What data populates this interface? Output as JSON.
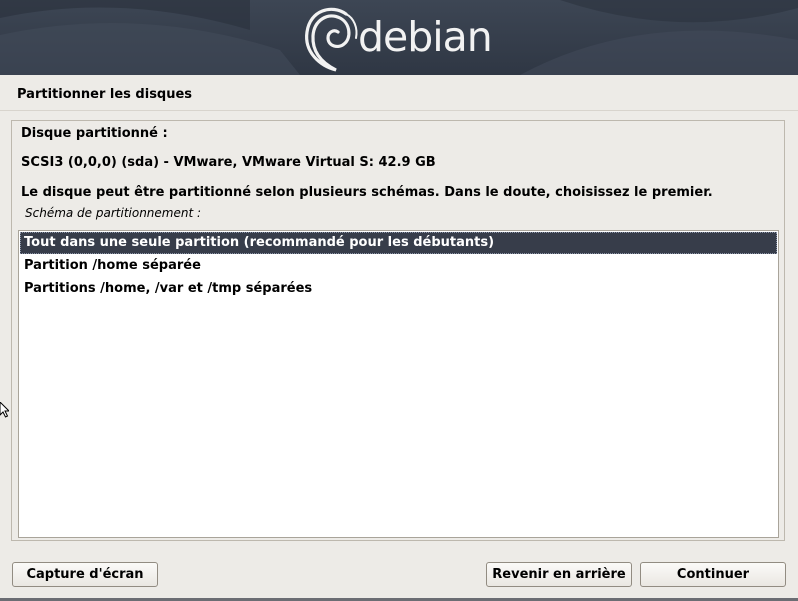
{
  "banner": {
    "logo_text": "debian"
  },
  "page": {
    "title": "Partitionner les disques"
  },
  "panel": {
    "disk_label": "Disque partitionné :",
    "disk_value": "SCSI3 (0,0,0) (sda) - VMware, VMware Virtual S: 42.9 GB",
    "description": "Le disque peut être partitionné selon plusieurs schémas. Dans le doute, choisissez le premier.",
    "scheme_label": "Schéma de partitionnement :"
  },
  "schemes": {
    "selected_index": 0,
    "items": [
      {
        "label": "Tout dans une seule partition (recommandé pour les débutants)"
      },
      {
        "label": "Partition /home séparée"
      },
      {
        "label": "Partitions /home, /var et /tmp séparées"
      }
    ]
  },
  "buttons": {
    "screenshot": "Capture d'écran",
    "back": "Revenir en arrière",
    "continue": "Continuer"
  },
  "icons": {
    "logo": "debian-swirl-icon",
    "pointer": "mouse-pointer-icon"
  },
  "colors": {
    "banner": "#353d4a",
    "background": "#edebe7",
    "selection": "#373d4a"
  }
}
